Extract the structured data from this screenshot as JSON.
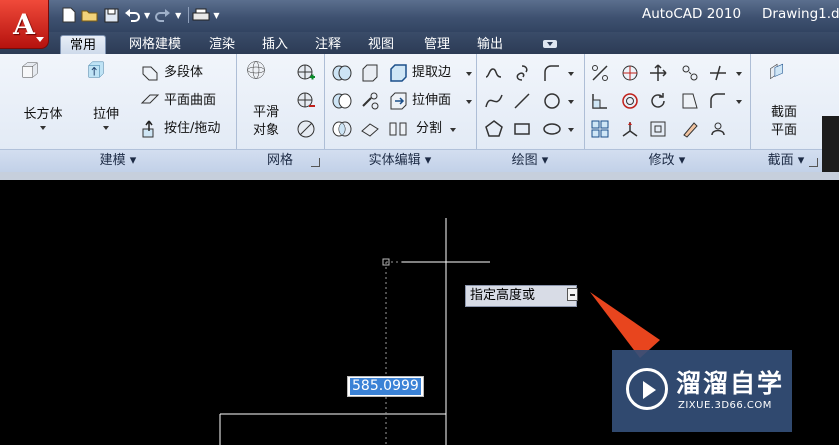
{
  "titlebar": {
    "app_title": "AutoCAD 2010",
    "doc_title": "Drawing1.d",
    "logo_letter": "A"
  },
  "tabs": [
    {
      "label": "常用",
      "active": true
    },
    {
      "label": "网格建模"
    },
    {
      "label": "渲染"
    },
    {
      "label": "插入"
    },
    {
      "label": "注释"
    },
    {
      "label": "视图"
    },
    {
      "label": "管理"
    },
    {
      "label": "输出"
    }
  ],
  "ribbon": {
    "modeling": {
      "title": "建模",
      "box_label": "长方体",
      "extrude_label": "拉伸",
      "polysolid_label": "多段体",
      "planar_surface_label": "平面曲面",
      "presspull_label": "按住/拖动"
    },
    "mesh": {
      "title": "网格",
      "smooth_label_1": "平滑",
      "smooth_label_2": "对象"
    },
    "solid_edit": {
      "title": "实体编辑",
      "extract_edges_label": "提取边",
      "extrude_faces_label": "拉伸面",
      "separate_label": "分割"
    },
    "draw": {
      "title": "绘图"
    },
    "modify": {
      "title": "修改"
    },
    "section": {
      "title": "截面",
      "section_plane_label_1": "截面",
      "section_plane_label_2": "平面"
    }
  },
  "canvas": {
    "prompt_text": "指定高度或",
    "dimension_value": "585.0999"
  },
  "watermark": {
    "title": "溜溜自学",
    "url": "ZIXUE.3D66.COM"
  },
  "colors": {
    "accent_arrow": "#e8451e",
    "selection": "#3b82d6",
    "title_bar": "#3e5170"
  }
}
